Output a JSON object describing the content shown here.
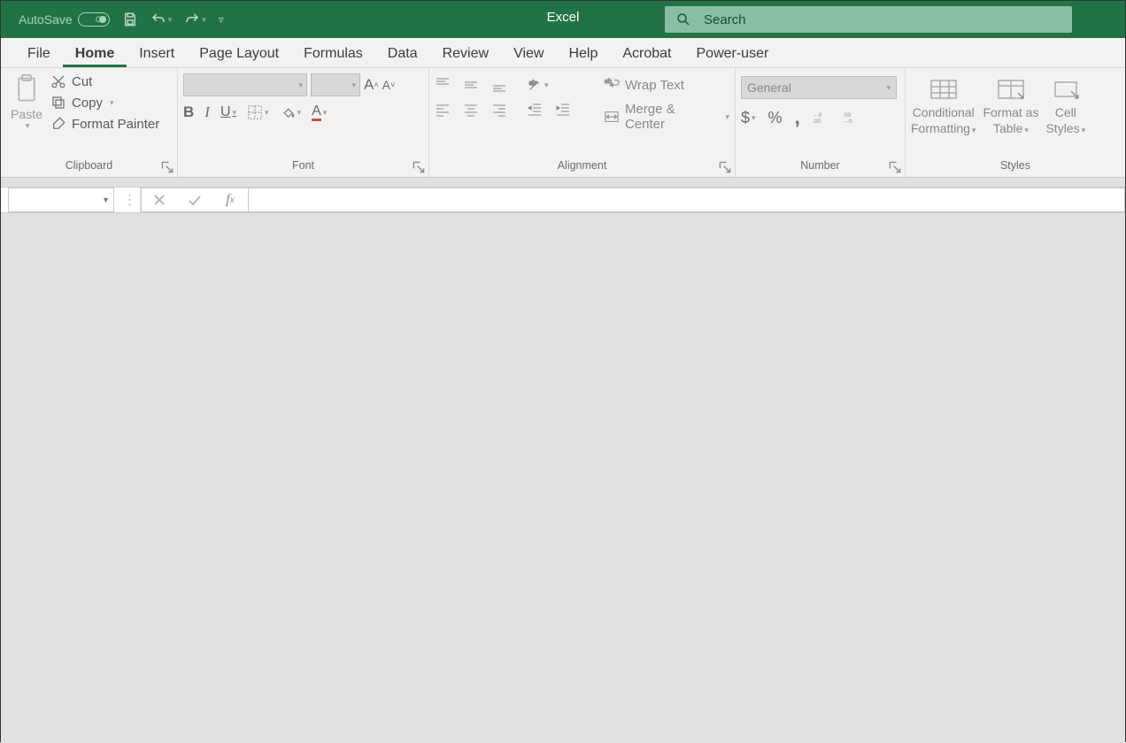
{
  "titlebar": {
    "autosave_label": "AutoSave",
    "autosave_state": "Off",
    "app_title": "Excel",
    "search_placeholder": "Search"
  },
  "tabs": [
    "File",
    "Home",
    "Insert",
    "Page Layout",
    "Formulas",
    "Data",
    "Review",
    "View",
    "Help",
    "Acrobat",
    "Power-user"
  ],
  "active_tab": "Home",
  "ribbon": {
    "clipboard": {
      "label": "Clipboard",
      "paste": "Paste",
      "cut": "Cut",
      "copy": "Copy",
      "format_painter": "Format Painter"
    },
    "font": {
      "label": "Font"
    },
    "alignment": {
      "label": "Alignment",
      "wrap": "Wrap Text",
      "merge": "Merge & Center"
    },
    "number": {
      "label": "Number",
      "format": "General"
    },
    "styles": {
      "label": "Styles",
      "conditional1": "Conditional",
      "conditional2": "Formatting",
      "formatas1": "Format as",
      "formatas2": "Table",
      "cell1": "Cell",
      "cell2": "Styles"
    }
  }
}
